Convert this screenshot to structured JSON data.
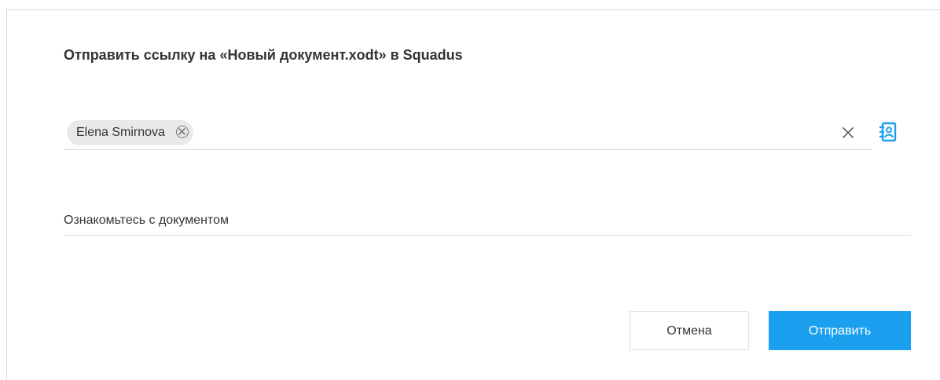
{
  "dialog": {
    "title": "Отправить ссылку на «Новый документ.xodt» в Squadus"
  },
  "recipients": {
    "chips": [
      {
        "label": "Elena Smirnova"
      }
    ],
    "clear_icon": "close-icon",
    "contacts_icon": "address-book-icon"
  },
  "message": {
    "value": "Ознакомьтесь с документом"
  },
  "actions": {
    "cancel_label": "Отмена",
    "send_label": "Отправить"
  },
  "colors": {
    "accent": "#1aa0ef",
    "chip_bg": "#e9e9e9"
  }
}
